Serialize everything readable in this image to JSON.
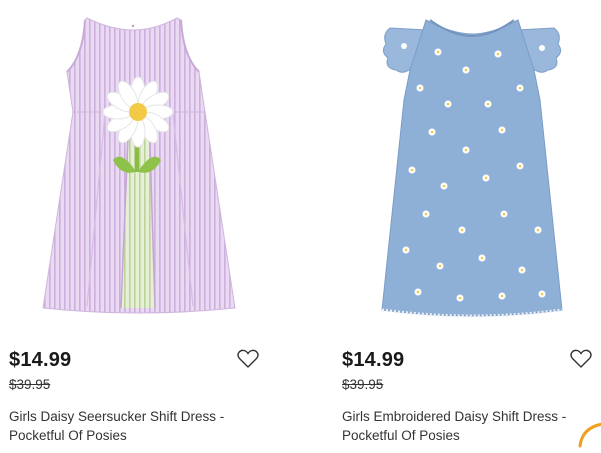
{
  "products": [
    {
      "image_alt": "Girls Daisy Seersucker Shift Dress",
      "price": "$14.99",
      "original_price": "$39.95",
      "title": "Girls Daisy Seersucker Shift Dress - Pocketful Of Posies",
      "wishlist_icon": "heart-outline-icon"
    },
    {
      "image_alt": "Girls Embroidered Daisy Shift Dress",
      "price": "$14.99",
      "original_price": "$39.95",
      "title": "Girls Embroidered Daisy Shift Dress - Pocketful Of Posies",
      "wishlist_icon": "heart-outline-icon"
    }
  ],
  "colors": {
    "lavender_dress": "#e4d3ee",
    "denim_dress": "#8fb0d6",
    "spinner_accent": "#f0a020"
  }
}
